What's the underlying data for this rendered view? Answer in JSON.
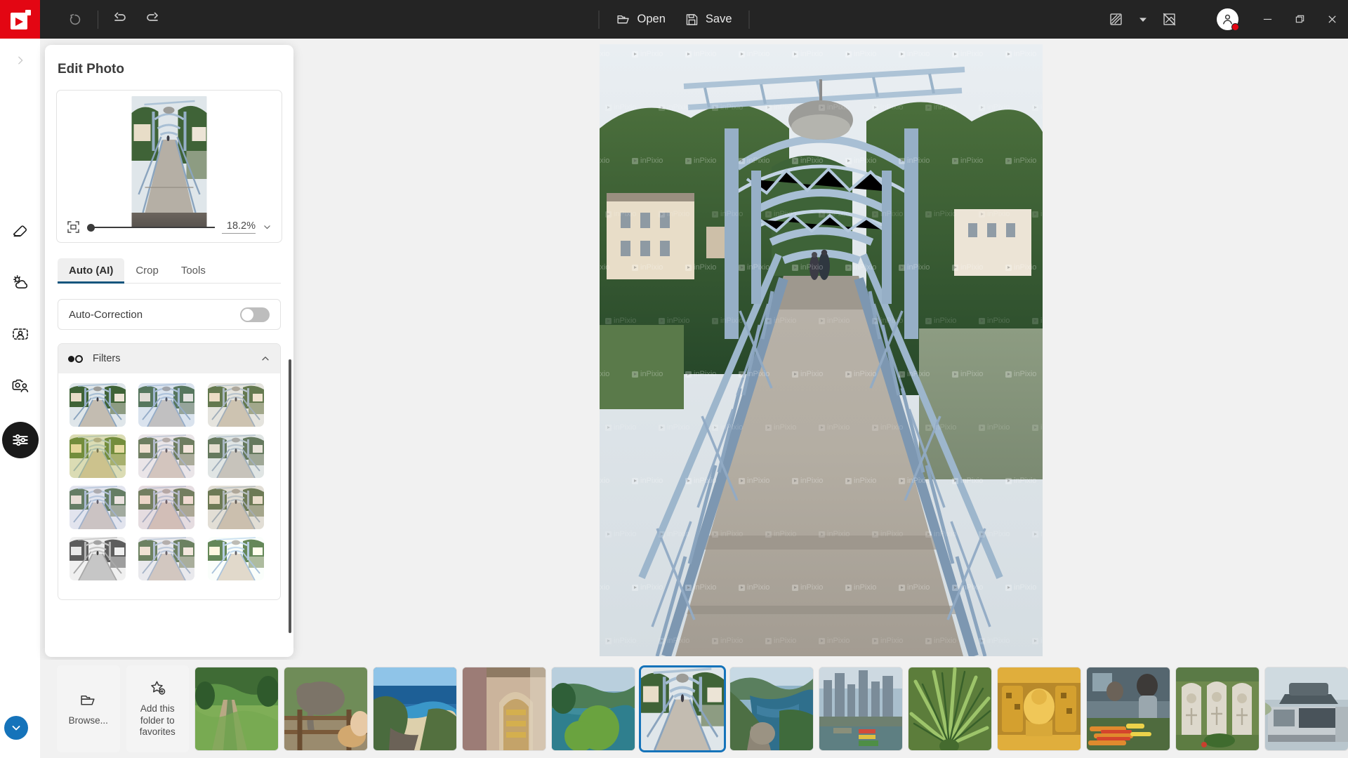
{
  "app": {
    "logo_name": "inpixio-logo",
    "accent_red": "#e30613",
    "accent_blue": "#1573ba",
    "tab_underline": "#14557d"
  },
  "titlebar": {
    "reset_label": "Reset",
    "undo_label": "Undo",
    "redo_label": "Redo",
    "open_label": "Open",
    "save_label": "Save",
    "compare_label": "Compare",
    "compare_dropdown_label": "Compare options",
    "hide_label": "Hide overlay",
    "account_label": "Account",
    "minimize_label": "Minimize",
    "restore_label": "Restore",
    "close_label": "Close"
  },
  "rail": {
    "expand_label": "Expand sidebar",
    "items": [
      {
        "name": "eraser",
        "label": "Eraser"
      },
      {
        "name": "sky-replace",
        "label": "Sky Replacement"
      },
      {
        "name": "portrait",
        "label": "Portrait"
      },
      {
        "name": "photo-people",
        "label": "People"
      },
      {
        "name": "adjustments",
        "label": "Adjustments",
        "active": true
      }
    ],
    "collapse_label": "Collapse"
  },
  "panel": {
    "title": "Edit Photo",
    "fit_icon_label": "Fit to screen",
    "zoom_value": "18.2%",
    "zoom_dropdown_label": "Zoom presets",
    "tabs": [
      {
        "label": "Auto (AI)",
        "active": true
      },
      {
        "label": "Crop",
        "active": false
      },
      {
        "label": "Tools",
        "active": false
      }
    ],
    "auto_correction": {
      "label": "Auto-Correction",
      "enabled": false
    },
    "filters": {
      "title": "Filters",
      "expanded": true,
      "items": [
        {
          "name": "original",
          "tint": "rgba(255,255,255,0)",
          "sat": 1.0,
          "bright": 1.0
        },
        {
          "name": "cool",
          "tint": "rgba(150,170,210,0.22)",
          "sat": 0.9,
          "bright": 1.06
        },
        {
          "name": "warm",
          "tint": "rgba(220,190,150,0.22)",
          "sat": 0.95,
          "bright": 1.04
        },
        {
          "name": "vivid-yellow",
          "tint": "rgba(215,205,90,0.38)",
          "sat": 1.35,
          "bright": 1.0
        },
        {
          "name": "soft-rose",
          "tint": "rgba(230,195,195,0.25)",
          "sat": 0.85,
          "bright": 1.05
        },
        {
          "name": "muted",
          "tint": "rgba(200,200,190,0.22)",
          "sat": 0.7,
          "bright": 1.03
        },
        {
          "name": "lavender",
          "tint": "rgba(200,190,220,0.25)",
          "sat": 0.9,
          "bright": 1.05
        },
        {
          "name": "blush",
          "tint": "rgba(235,185,190,0.30)",
          "sat": 1.0,
          "bright": 1.02
        },
        {
          "name": "sepia",
          "tint": "rgba(210,180,140,0.28)",
          "sat": 0.8,
          "bright": 1.04
        },
        {
          "name": "mono",
          "tint": "rgba(255,255,255,0)",
          "sat": 0.0,
          "bright": 1.05
        },
        {
          "name": "pastel",
          "tint": "rgba(225,200,205,0.26)",
          "sat": 0.95,
          "bright": 1.06
        },
        {
          "name": "bright",
          "tint": "rgba(255,250,235,0.18)",
          "sat": 1.1,
          "bright": 1.12
        }
      ]
    }
  },
  "canvas": {
    "watermark_text": "inPixio",
    "photo_label": "Blue steel footbridge over river"
  },
  "filmstrip": {
    "browse_label": "Browse...",
    "favorites_label": "Add this folder to favorites",
    "thumbnails": [
      {
        "name": "rice-terraces",
        "label": "Rice terraces path",
        "selected": false
      },
      {
        "name": "elephant",
        "label": "Elephant at fence",
        "selected": false
      },
      {
        "name": "coastal-beach",
        "label": "Coastal beach cove",
        "selected": false
      },
      {
        "name": "temple-arch",
        "label": "Ornate temple arch",
        "selected": false
      },
      {
        "name": "lake-greenery",
        "label": "Lake with greenery",
        "selected": false
      },
      {
        "name": "blue-bridge",
        "label": "Blue steel footbridge",
        "selected": true
      },
      {
        "name": "mountain-lake",
        "label": "Mountain lake view",
        "selected": false
      },
      {
        "name": "city-skyline",
        "label": "City skyline bay",
        "selected": false
      },
      {
        "name": "palm-fronds",
        "label": "Green palm fronds",
        "selected": false
      },
      {
        "name": "gold-carving",
        "label": "Gold temple carving",
        "selected": false
      },
      {
        "name": "food-market",
        "label": "Street food market",
        "selected": false
      },
      {
        "name": "headstones",
        "label": "War grave headstones",
        "selected": false
      },
      {
        "name": "camper-van",
        "label": "Camper van",
        "selected": false
      }
    ]
  }
}
